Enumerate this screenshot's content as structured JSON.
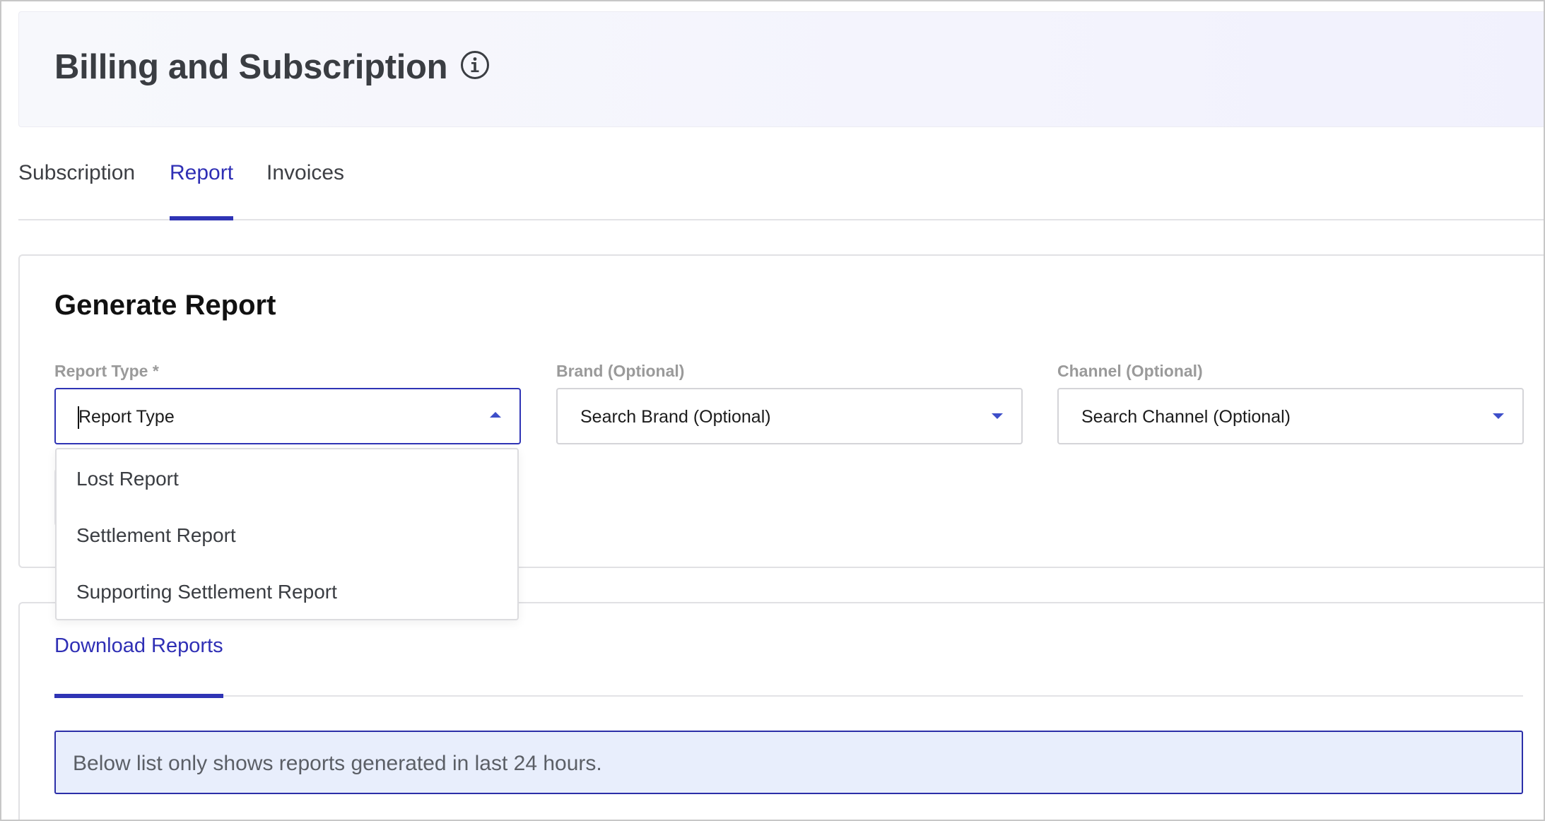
{
  "header": {
    "title": "Billing and Subscription",
    "info_icon": "info-icon"
  },
  "tabs": [
    {
      "label": "Subscription",
      "active": false
    },
    {
      "label": "Report",
      "active": true
    },
    {
      "label": "Invoices",
      "active": false
    }
  ],
  "generate_report": {
    "title": "Generate Report",
    "report_type": {
      "label": "Report Type *",
      "value": "Report Type",
      "open": true,
      "options": [
        "Lost Report",
        "Settlement Report",
        "Supporting Settlement Report"
      ]
    },
    "brand": {
      "label": "Brand (Optional)",
      "placeholder": "Search Brand (Optional)"
    },
    "channel": {
      "label": "Channel (Optional)",
      "placeholder": "Search Channel (Optional)"
    }
  },
  "download_reports": {
    "tab_label": "Download Reports",
    "notice": "Below list only shows reports generated in last 24 hours."
  },
  "colors": {
    "accent": "#2f34b5",
    "notice_bg": "#e8eefc",
    "header_bg": "#f4f4fd"
  }
}
